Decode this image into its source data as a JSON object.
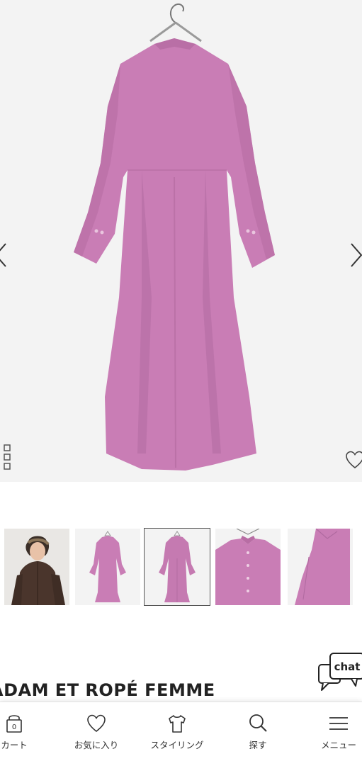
{
  "product": {
    "brand": "ADAM ET ROPÉ FEMME",
    "color_hex": "#c97db5"
  },
  "gallery": {
    "prev_icon": "chevron-left-icon",
    "next_icon": "chevron-right-icon",
    "grid_icon": "grid-icon",
    "favorite_icon": "heart-icon",
    "thumbnails": [
      {
        "name": "model-photo"
      },
      {
        "name": "dress-front"
      },
      {
        "name": "dress-back",
        "selected": true
      },
      {
        "name": "collar-detail"
      },
      {
        "name": "sleeve-detail"
      }
    ]
  },
  "chat": {
    "label": "chat"
  },
  "bottom_nav": {
    "items": [
      {
        "label": "カート",
        "icon": "cart-icon",
        "badge": "0"
      },
      {
        "label": "お気に入り",
        "icon": "heart-icon"
      },
      {
        "label": "スタイリング",
        "icon": "shirt-icon"
      },
      {
        "label": "探す",
        "icon": "search-icon"
      },
      {
        "label": "メニュー",
        "icon": "menu-icon"
      }
    ]
  }
}
